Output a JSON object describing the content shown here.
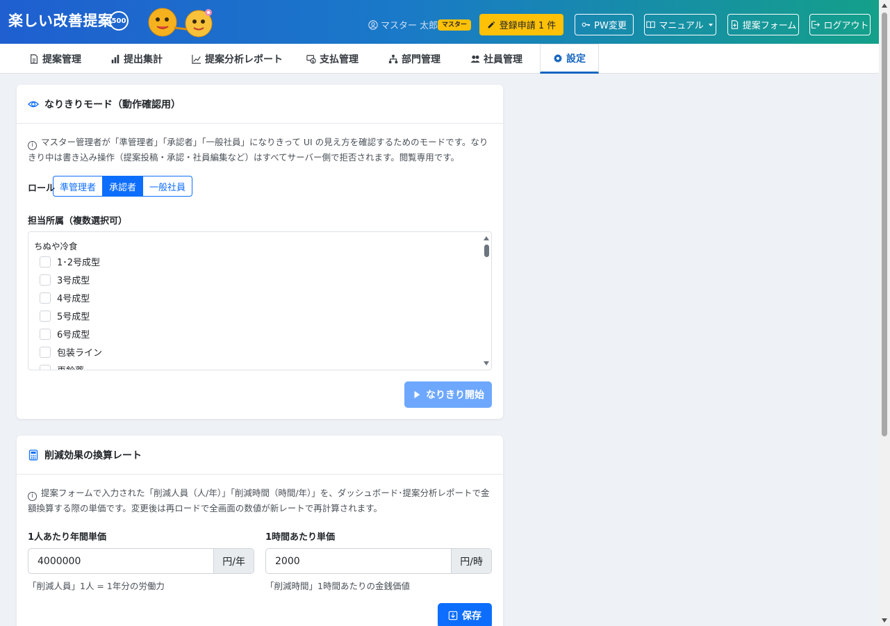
{
  "header": {
    "app_title": "楽しい改善提案",
    "badge": "500",
    "user_name": "マスター 太郎",
    "role_badge": "マスター",
    "buttons": {
      "register": "登録申請 1 件",
      "pw_change": "PW変更",
      "manual": "マニュアル",
      "proposal_form": "提案フォーム",
      "logout": "ログアウト"
    },
    "colors": {
      "gradient_start": "#1f5fd0",
      "gradient_end": "#14a08a",
      "warning": "#ffc107"
    }
  },
  "tabs": [
    {
      "label": "提案管理",
      "icon": "document-icon"
    },
    {
      "label": "提出集計",
      "icon": "bar-chart-icon"
    },
    {
      "label": "提案分析レポート",
      "icon": "line-chart-icon"
    },
    {
      "label": "支払管理",
      "icon": "payment-icon"
    },
    {
      "label": "部門管理",
      "icon": "org-chart-icon"
    },
    {
      "label": "社員管理",
      "icon": "people-icon"
    },
    {
      "label": "設定",
      "icon": "gear-icon",
      "active": true
    }
  ],
  "impersonation": {
    "title": "なりきりモード（動作確認用）",
    "info": "マスター管理者が「準管理者」「承認者」「一般社員」になりきって UI の見え方を確認するためのモードです。なりきり中は書き込み操作（提案投稿・承認・社員編集など）はすべてサーバー側で拒否されます。閲覧専用です。",
    "role_label": "ロール",
    "roles": [
      "準管理者",
      "承認者",
      "一般社員"
    ],
    "selected_role": "承認者",
    "dept_label": "担当所属（複数選択可）",
    "dept_group": "ちぬや冷食",
    "departments": [
      "1･2号成型",
      "3号成型",
      "4号成型",
      "5号成型",
      "6号成型",
      "包装ライン",
      "再鈴薬"
    ],
    "start_button": "なりきり開始"
  },
  "conversion": {
    "title": "削減効果の換算レート",
    "info": "提案フォームで入力された「削減人員（人/年）」「削減時間（時間/年）」を、ダッシュボード･提案分析レポートで金額換算する際の単価です。変更後は再ロードで全画面の数値が新レートで再計算されます。",
    "annual_label": "1人あたり年間単価",
    "annual_value": "4000000",
    "annual_unit": "円/年",
    "annual_help": "「削減人員」1人 = 1年分の労働力",
    "hourly_label": "1時間あたり単価",
    "hourly_value": "2000",
    "hourly_unit": "円/時",
    "hourly_help": "「削減時間」1時間あたりの金銭価値",
    "save_button": "保存"
  }
}
